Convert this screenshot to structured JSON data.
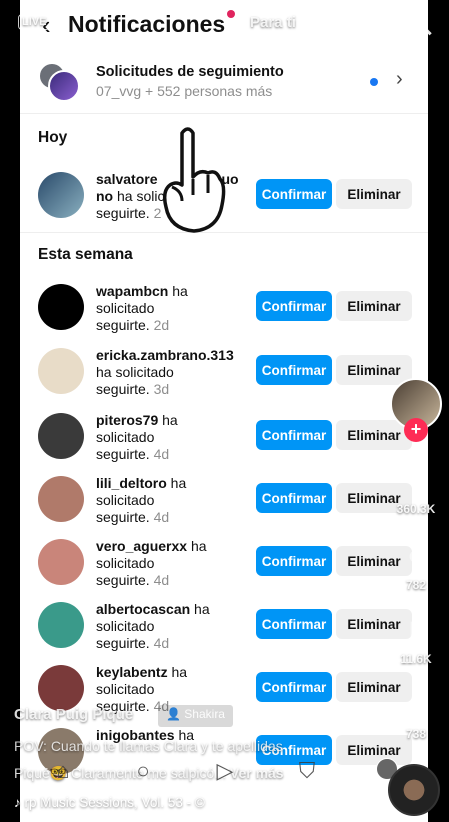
{
  "header": {
    "title": "Notificaciones",
    "back_icon": "chevron-left-icon"
  },
  "tiktok": {
    "live_label": "LIVE",
    "tab_for_you": "Para ti",
    "creator_name": "Clara Puig Piqué",
    "collab_tag": "Shakira",
    "caption_line1": "POV: Cuando te llamas Clara y te apellidas",
    "caption_line2_prefix": "Piqué",
    "caption_line2_emoji": "🤓",
    "caption_line2_text": " Claramente me salpicó...",
    "see_more": "Ver más",
    "music": "rp Music Sessions, Vol. 53 - ©",
    "likes": "360.3K",
    "comments": "782",
    "saves": "11.6K",
    "shares": "738",
    "follow_plus": "+"
  },
  "follow_requests": {
    "title": "Solicitudes de seguimiento",
    "subtitle": "07_vvg + 552 personas más"
  },
  "sections": {
    "today": "Hoy",
    "this_week": "Esta semana"
  },
  "buttons": {
    "confirm": "Confirmar",
    "delete": "Eliminar"
  },
  "today_items": [
    {
      "username": "salvatore",
      "username_tail": "uo",
      "line2_prefix": "no",
      "text": " ha solici",
      "line3": "seguirte.",
      "age": "2",
      "avatar_color": "#5a7a8a"
    }
  ],
  "week_items": [
    {
      "username": "wapambcn",
      "suffix": " ha",
      "line2": "solicitado",
      "line3": "seguirte.",
      "age": "2d",
      "avatar_color": "#000000"
    },
    {
      "username": "ericka.zambrano.313",
      "suffix": "",
      "line2": "ha solicitado",
      "line3": "seguirte.",
      "age": "3d",
      "avatar_color": "#e8dcc8"
    },
    {
      "username": "piteros79",
      "suffix": " ha",
      "line2": "solicitado",
      "line3": "seguirte.",
      "age": "4d",
      "avatar_color": "#3a3a3a"
    },
    {
      "username": "lili_deltoro",
      "suffix": " ha",
      "line2": "solicitado",
      "line3": "seguirte.",
      "age": "4d",
      "avatar_color": "#b07a6a"
    },
    {
      "username": "vero_aguerxx",
      "suffix": " ha",
      "line2": "solicitado",
      "line3": "seguirte.",
      "age": "4d",
      "avatar_color": "#c9857a"
    },
    {
      "username": "albertocascan",
      "suffix": " ha",
      "line2": "solicitado",
      "line3": "seguirte.",
      "age": "4d",
      "avatar_color": "#3a9a8a"
    },
    {
      "username": "keylabentz",
      "suffix": " ha",
      "line2": "solicitado",
      "line3": "seguirte.",
      "age": "4d",
      "avatar_color": "#7a3a3a"
    },
    {
      "username": "inigobantes",
      "suffix": " ha",
      "line2": "",
      "line3": "",
      "age": "",
      "avatar_color": "#8a7a6a"
    }
  ],
  "colors": {
    "confirm_blue": "#0095f6",
    "delete_gray": "#efefef",
    "tiktok_red": "#fe2c55",
    "notification_dot": "#1877f2"
  }
}
